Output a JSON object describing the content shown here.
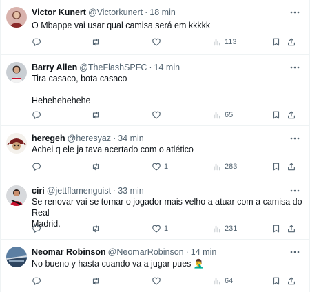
{
  "tweets": [
    {
      "name": "Victor Kunert",
      "handle": "@Victorkunert",
      "time": "18 min",
      "lines": [
        "O Mbappe vai usar qual camisa será em kkkkk"
      ],
      "likes": "",
      "views": "113",
      "avatar_color": "#c98b8b"
    },
    {
      "name": "Barry Allen",
      "handle": "@TheFlashSPFC",
      "time": "14 min",
      "lines": [
        "Tira casaco, bota casaco",
        "",
        "Hehehehehehe"
      ],
      "likes": "",
      "views": "65",
      "avatar_color": "#9aa3ab"
    },
    {
      "name": "heregeh",
      "handle": "@heresyaz",
      "time": "34 min",
      "lines": [
        "Achei q ele ja tava acertado com o atlético"
      ],
      "likes": "1",
      "views": "283",
      "avatar_color": "#e8e4df"
    },
    {
      "name": "ciri",
      "handle": "@jettflamenguist",
      "time": "33 min",
      "lines": [
        "Se renovar vai se tornar o jogador mais velho a atuar com a camisa do Real",
        "Madrid."
      ],
      "likes": "1",
      "views": "231",
      "avatar_color": "#b3262b"
    },
    {
      "name": "Neomar Robinson",
      "handle": "@NeomarRobinson",
      "time": "14 min",
      "lines": [
        "No bueno y hasta cuando va a jugar pues 🤦‍♂️"
      ],
      "likes": "",
      "views": "64",
      "avatar_color": "#3d5a7a"
    }
  ],
  "separator": "·",
  "icons": {
    "more": "more-icon",
    "reply": "reply-icon",
    "retweet": "retweet-icon",
    "like": "heart-icon",
    "views": "views-icon",
    "bookmark": "bookmark-icon",
    "share": "share-icon"
  },
  "colors": {
    "text": "#0f1419",
    "muted": "#536471",
    "divider": "#eff3f4"
  }
}
